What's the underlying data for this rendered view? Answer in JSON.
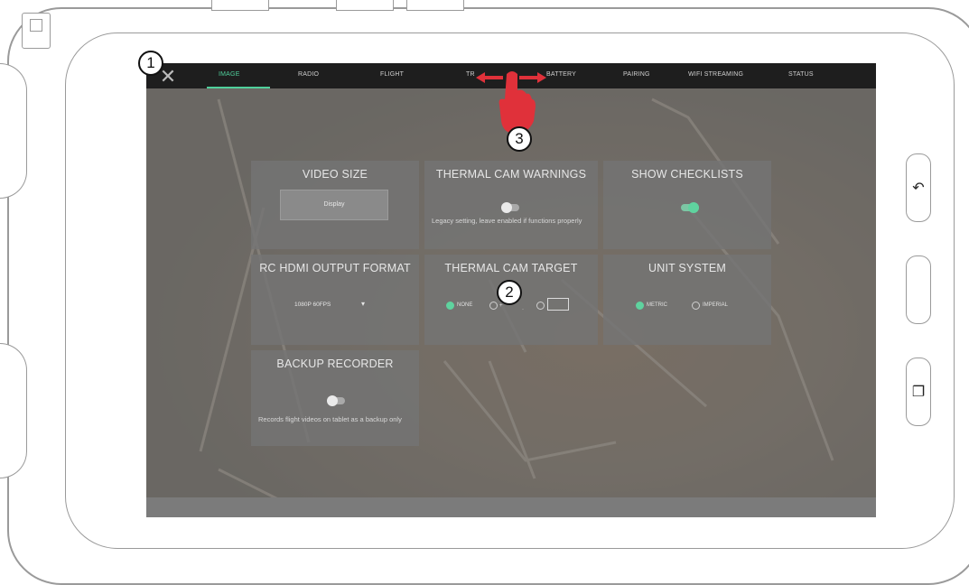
{
  "tabs": [
    {
      "label": "IMAGE",
      "active": true
    },
    {
      "label": "RADIO"
    },
    {
      "label": "FLIGHT"
    },
    {
      "label": "TR"
    },
    {
      "label": "BATTERY"
    },
    {
      "label": "PAIRING"
    },
    {
      "label": "WIFI STREAMING"
    },
    {
      "label": "STATUS"
    }
  ],
  "panels": {
    "video_size": {
      "title": "VIDEO SIZE",
      "value": "Display"
    },
    "thermal_warnings": {
      "title": "THERMAL CAM WARNINGS",
      "toggle_state": "off",
      "description": "Legacy setting, leave enabled if functions properly"
    },
    "show_checklists": {
      "title": "SHOW CHECKLISTS",
      "toggle_state": "on"
    },
    "rc_hdmi": {
      "title": "RC HDMI OUTPUT FORMAT",
      "value": "1080P 60FPS"
    },
    "thermal_target": {
      "title": "THERMAL CAM TARGET",
      "options": [
        "NONE",
        "",
        ""
      ]
    },
    "unit_system": {
      "title": "UNIT SYSTEM",
      "options": [
        "METRIC",
        "IMPERIAL"
      ],
      "selected": "METRIC"
    },
    "backup_recorder": {
      "title": "BACKUP RECORDER",
      "toggle_state": "off",
      "description": "Records flight videos on tablet as a backup only"
    }
  },
  "callouts": [
    "1",
    "2",
    "3"
  ],
  "colors": {
    "accent": "#4fcf9b",
    "topbar": "#1e1e1e",
    "gesture": "#e0313a"
  },
  "icons": {
    "close": "close-icon",
    "swipe": "swipe-gesture-icon",
    "back": "back-icon",
    "recents": "recents-icon"
  }
}
